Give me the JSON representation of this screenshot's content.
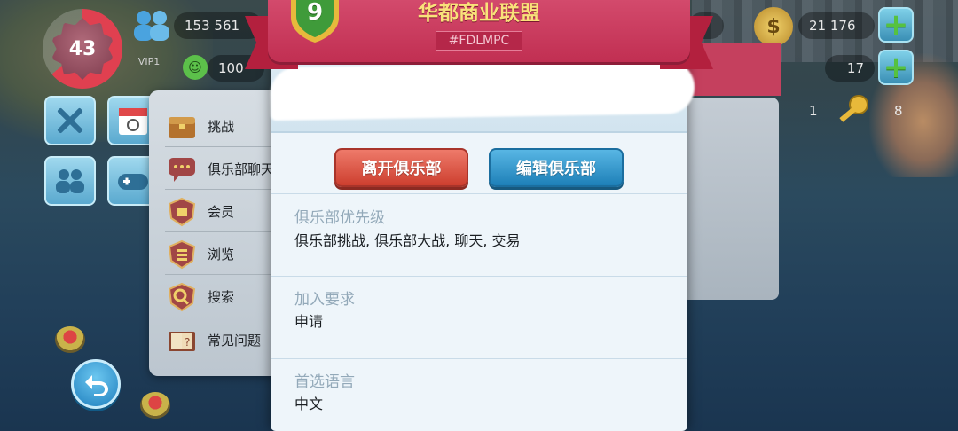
{
  "hud": {
    "level": "43",
    "population": "153 561",
    "vip_label": "VIP1",
    "happiness": "100",
    "simcash": "21 176",
    "golden_keys": "17",
    "left_counter": "1",
    "right_counter": "8",
    "top_partial": "8"
  },
  "side_menu": {
    "items": [
      {
        "label": "挑战",
        "icon": "chest-icon"
      },
      {
        "label": "俱乐部聊天",
        "icon": "chat-icon"
      },
      {
        "label": "会员",
        "icon": "members-icon"
      },
      {
        "label": "浏览",
        "icon": "browse-icon"
      },
      {
        "label": "搜索",
        "icon": "search-icon"
      },
      {
        "label": "常见问题",
        "icon": "faq-book-icon"
      }
    ]
  },
  "club": {
    "level_badge": "9",
    "name": "华都商业联盟",
    "tag": "#FDLMPC",
    "leave_button": "离开俱乐部",
    "edit_button": "编辑俱乐部",
    "sections": [
      {
        "title": "俱乐部优先级",
        "value": "俱乐部挑战, 俱乐部大战, 聊天, 交易"
      },
      {
        "title": "加入要求",
        "value": "申请"
      },
      {
        "title": "首选语言",
        "value": "中文"
      }
    ]
  },
  "colors": {
    "banner": "#c93a5c",
    "club_name": "#f9e27a",
    "leave_button": "#d94a38",
    "edit_button": "#2a8cc4",
    "section_title": "#93a9b9"
  }
}
